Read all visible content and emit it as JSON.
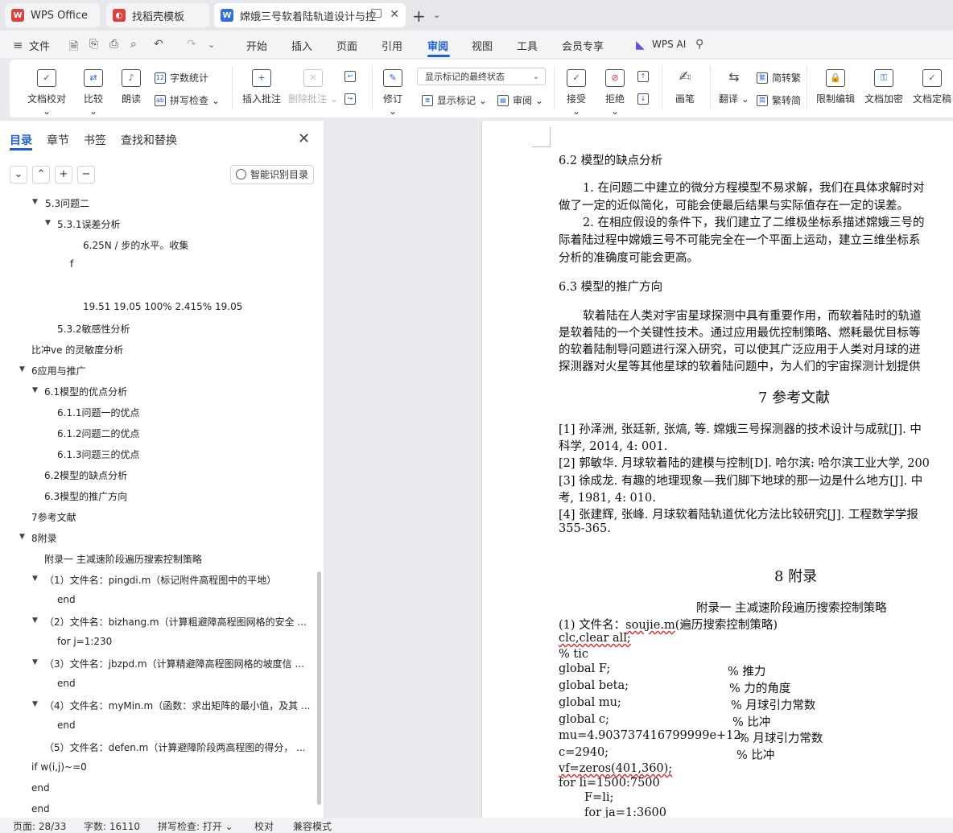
{
  "tabs": [
    {
      "label": "WPS Office",
      "icon": "wps-logo-icon"
    },
    {
      "label": "找稻壳模板",
      "icon": "docer-icon"
    },
    {
      "label": "嫦娥三号软着陆轨道设计与控",
      "icon": "writer-doc-icon"
    }
  ],
  "menu": {
    "file": "文件",
    "items": [
      "开始",
      "插入",
      "页面",
      "引用",
      "审阅",
      "视图",
      "工具",
      "会员专享"
    ],
    "active": "审阅",
    "ai": "WPS AI"
  },
  "ribbon": {
    "doc_check": "文档校对",
    "compare": "比较",
    "read_aloud": "朗读",
    "word_count": "字数统计",
    "spell_check": "拼写检查",
    "insert_comment": "插入批注",
    "delete_comment": "删除批注",
    "revise": "修订",
    "markup_state": "显示标记的最终状态",
    "show_markup": "显示标记",
    "review_pane": "审阅",
    "accept": "接受",
    "reject": "拒绝",
    "pen": "画笔",
    "translate": "翻译",
    "to_traditional": "简转繁",
    "to_simplified": "繁转简",
    "restrict_edit": "限制编辑",
    "encrypt": "文档加密",
    "finalize": "文档定稿"
  },
  "nav": {
    "tabs": [
      "目录",
      "章节",
      "书签",
      "查找和替换"
    ],
    "smart_toc": "智能识别目录",
    "items": [
      {
        "text": "5.3问题二"
      },
      {
        "text": "5.3.1误差分析"
      },
      {
        "text": "6.25N / 步的水平。收集"
      },
      {
        "text": "f"
      },
      {
        "text": "19.51    19.05     100%      2.415% 19.05"
      },
      {
        "text": "5.3.2敏感性分析"
      },
      {
        "text": "比冲ve 的灵敏度分析"
      },
      {
        "text": "6应用与推广"
      },
      {
        "text": "6.1模型的优点分析"
      },
      {
        "text": "6.1.1问题一的优点"
      },
      {
        "text": "6.1.2问题二的优点"
      },
      {
        "text": "6.1.3问题三的优点"
      },
      {
        "text": "6.2模型的缺点分析"
      },
      {
        "text": "6.3模型的推广方向"
      },
      {
        "text": "7参考文献"
      },
      {
        "text": "8附录"
      },
      {
        "text": "附录一 主减速阶段遍历搜索控制策略"
      },
      {
        "text": "（1）文件名：pingdi.m（标记附件高程图中的平地）"
      },
      {
        "text": "end"
      },
      {
        "text": "（2）文件名：bizhang.m（计算粗避障高程图网格的安全 ..."
      },
      {
        "text": "for j=1:230"
      },
      {
        "text": "（3）文件名：jbzpd.m（计算精避障高程图网格的坡度信 ..."
      },
      {
        "text": "end"
      },
      {
        "text": "（4）文件名：myMin.m（函数：求出矩阵的最小值，及其 ..."
      },
      {
        "text": "end"
      },
      {
        "text": "（5）文件名：defen.m（计算避障阶段两高程图的得分，  ..."
      },
      {
        "text": "if w(i,j)~=0"
      },
      {
        "text": "end"
      },
      {
        "text": "end"
      }
    ]
  },
  "document": {
    "s62_title": "6.2  模型的缺点分析",
    "s62_p1a": "1.  在问题二中建立的微分方程模型不易求解，我们在具体求解时对",
    "s62_p1b": "做了一定的近似简化，可能会使最后结果与实际值存在一定的误差。",
    "s62_p2a": "2.  在相应假设的条件下，我们建立了二维极坐标系描述嫦娥三号的",
    "s62_p2b": "际着陆过程中嫦娥三号不可能完全在一个平面上运动，建立三维坐标系",
    "s62_p2c": "分析的准确度可能会更高。",
    "s63_title": "6.3  模型的推广方向",
    "s63_p1a": "软着陆在人类对宇宙星球探测中具有重要作用，而软着陆时的轨道",
    "s63_p1b": "是软着陆的一个关键性技术。通过应用最优控制策略、燃耗最优目标等",
    "s63_p1c": "的软着陆制导问题进行深入研究，可以使其广泛应用于人类对月球的进",
    "s63_p1d": "探测器对火星等其他星球的软着陆问题中，为人们的宇宙探测计划提供",
    "s7_title": "7    参考文献",
    "ref1a": "[1]   孙泽洲, 张廷新, 张熇, 等. 嫦娥三号探测器的技术设计与成就[J]. 中",
    "ref1b": "科学, 2014, 4: 001.",
    "ref2": "[2]   郭敏华. 月球软着陆的建模与控制[D]. 哈尔滨: 哈尔滨工业大学, 200",
    "ref3a": "[3]   徐成龙. 有趣的地理现象—我们脚下地球的那一边是什么地方[J]. 中",
    "ref3b": "考, 1981, 4: 010.",
    "ref4a": "[4]   张建辉, 张峰. 月球软着陆轨道优化方法比较研究[J]. 工程数学学报",
    "ref4b": "355-365.",
    "s8_title": "8    附录",
    "app1_title": "附录一 主减速阶段遍历搜索控制策略",
    "file1_pre": "(1) 文件名：",
    "file1_name": "soujie.m",
    "file1_post": "(遍历搜索控制策略)",
    "code": [
      {
        "left": "clc,clear all;",
        "right": ""
      },
      {
        "left": "% tic",
        "right": ""
      },
      {
        "left": "global  F;",
        "right": "% 推力"
      },
      {
        "left": "global  beta;",
        "right": "% 力的角度"
      },
      {
        "left": "global  mu;",
        "right": "% 月球引力常数"
      },
      {
        "left": "global  c;",
        "right": "%  比冲"
      },
      {
        "left": "mu=4.903737416799999e+12;",
        "right": "% 月球引力常数"
      },
      {
        "left": "c=2940;",
        "right": "% 比冲"
      },
      {
        "left": "vf=zeros(401,360);",
        "right": ""
      },
      {
        "left": "for li=1500:7500",
        "right": ""
      },
      {
        "left": "F=li;",
        "right": ""
      },
      {
        "left": "for ja=1:3600",
        "right": ""
      }
    ]
  },
  "status": {
    "page": "页面: 28/33",
    "words": "字数: 16110",
    "spell": "拼写检查: 打开",
    "proof": "校对",
    "compat": "兼容模式"
  },
  "colors": {
    "accent": "#1f5ed6",
    "wps_red": "#e0403a",
    "writer_blue": "#2f6ee6"
  }
}
